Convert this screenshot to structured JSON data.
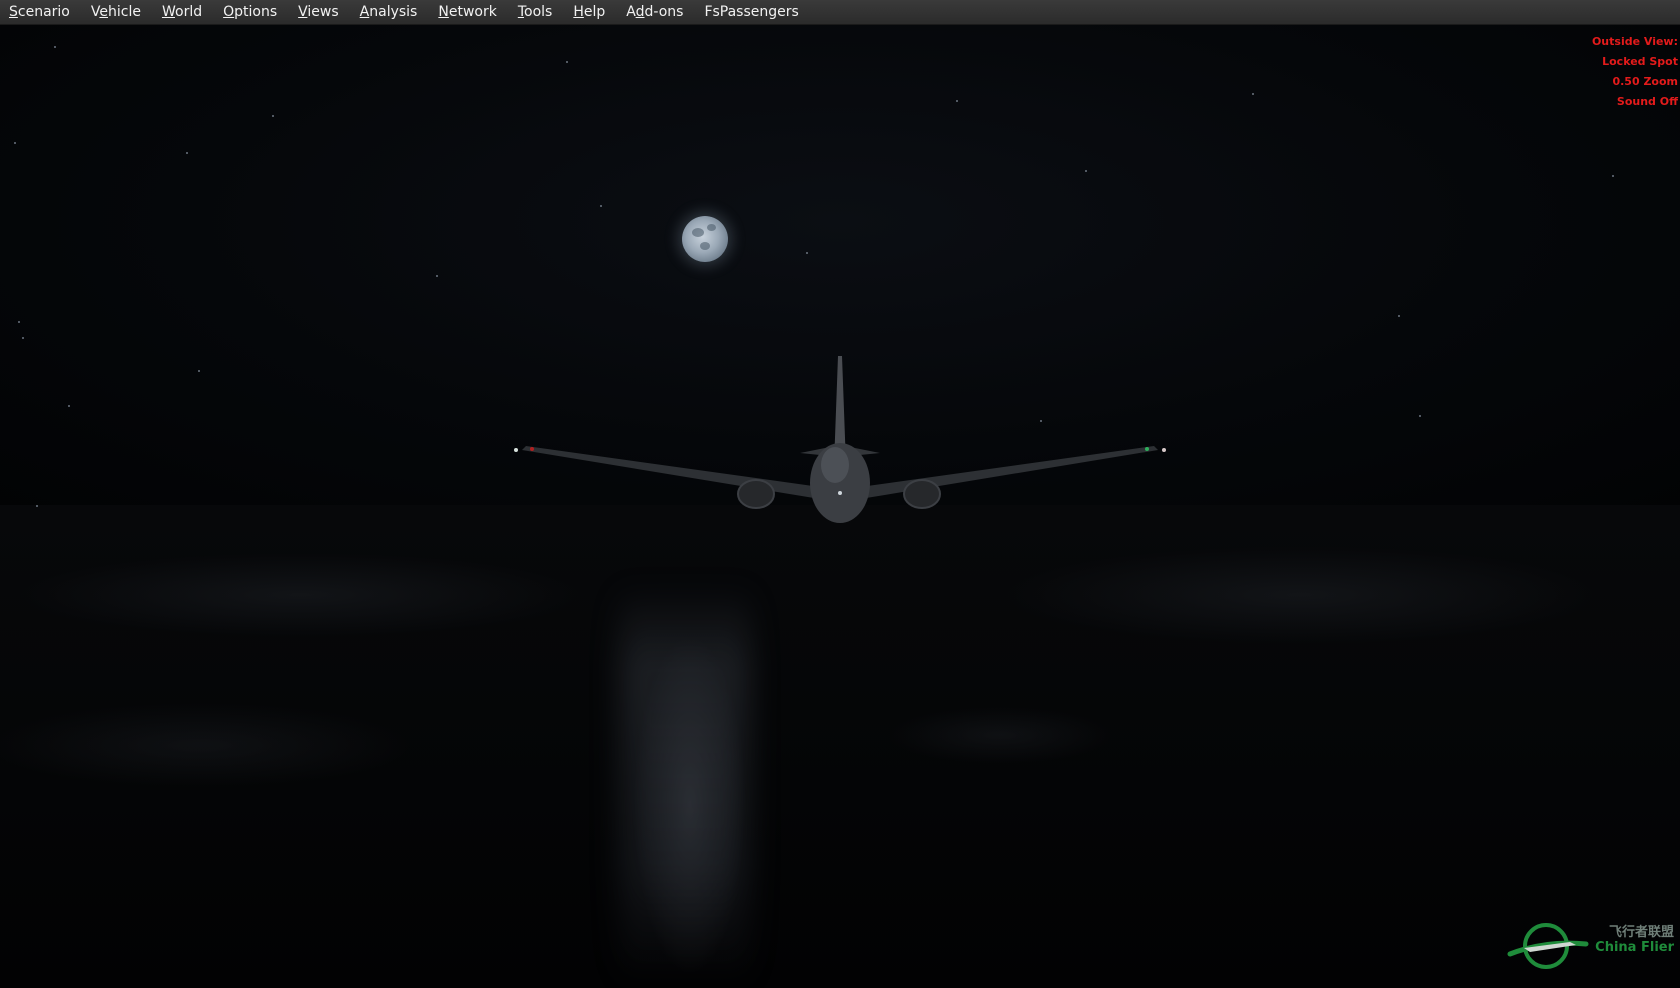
{
  "menu": {
    "items": [
      {
        "prefix": "",
        "mnemonic": "S",
        "rest": "cenario"
      },
      {
        "prefix": "V",
        "mnemonic": "e",
        "rest": "hicle"
      },
      {
        "prefix": "",
        "mnemonic": "W",
        "rest": "orld"
      },
      {
        "prefix": "",
        "mnemonic": "O",
        "rest": "ptions"
      },
      {
        "prefix": "",
        "mnemonic": "V",
        "rest": "iews"
      },
      {
        "prefix": "",
        "mnemonic": "A",
        "rest": "nalysis"
      },
      {
        "prefix": "",
        "mnemonic": "N",
        "rest": "etwork"
      },
      {
        "prefix": "",
        "mnemonic": "T",
        "rest": "ools"
      },
      {
        "prefix": "",
        "mnemonic": "H",
        "rest": "elp"
      },
      {
        "prefix": "A",
        "mnemonic": "d",
        "rest": "d-ons"
      },
      {
        "prefix": "",
        "mnemonic": "",
        "rest": "FsPassengers"
      }
    ]
  },
  "hud": {
    "view": "Outside View:",
    "mode": "Locked Spot",
    "zoom": "0.50 Zoom",
    "sound": "Sound Off"
  },
  "watermark": {
    "cn": "飞行者联盟",
    "en": "China Flier",
    "colors": {
      "green": "#1f8c3b",
      "gray": "#6f7f78"
    }
  },
  "colors": {
    "menu_bg": "#2f2f2f",
    "menu_text": "#f2f2f2",
    "hud_text": "#e41b1b",
    "sky": "#05070a",
    "moon": "#aab6c2"
  }
}
